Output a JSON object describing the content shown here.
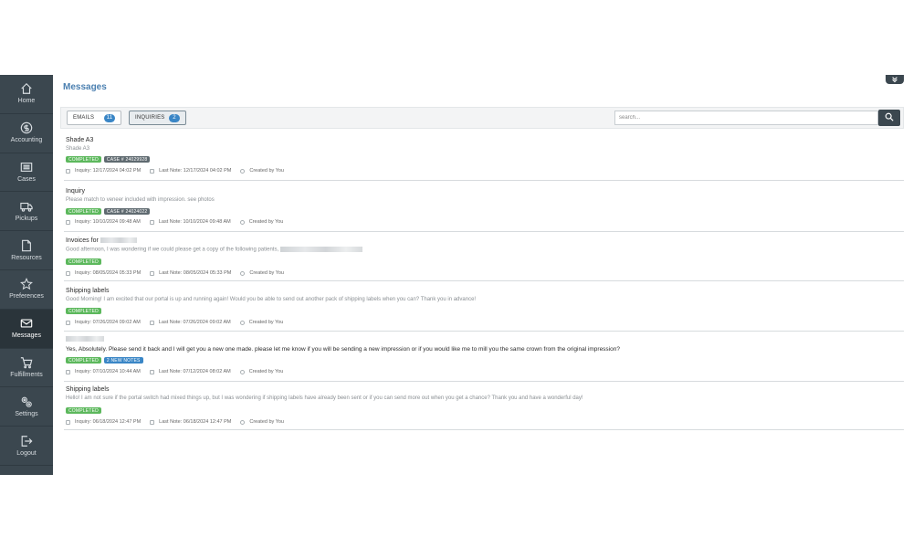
{
  "sidebar": {
    "items": [
      {
        "label": "Home",
        "icon": "home-icon"
      },
      {
        "label": "Accounting",
        "icon": "dollar-icon"
      },
      {
        "label": "Cases",
        "icon": "list-icon"
      },
      {
        "label": "Pickups",
        "icon": "truck-icon"
      },
      {
        "label": "Resources",
        "icon": "document-icon"
      },
      {
        "label": "Preferences",
        "icon": "star-icon"
      },
      {
        "label": "Messages",
        "icon": "envelope-icon",
        "active": true
      },
      {
        "label": "Fulfillments",
        "icon": "cart-icon"
      },
      {
        "label": "Settings",
        "icon": "gears-icon"
      },
      {
        "label": "Logout",
        "icon": "logout-icon"
      }
    ]
  },
  "header": {
    "title": "Messages"
  },
  "tabs": {
    "emails": {
      "label": "EMAILS",
      "count": "11"
    },
    "inquiries": {
      "label": "INQUIRIES",
      "count": "2"
    }
  },
  "search": {
    "placeholder": "search..."
  },
  "messages": [
    {
      "title": "Shade A3",
      "preview": "Shade A3",
      "badges": [
        "COMPLETED",
        "CASE # 24029928"
      ],
      "inquiry": "Inquiry: 12/17/2024 04:02 PM",
      "last_note": "Last Note: 12/17/2024 04:02 PM",
      "created": "Created by You"
    },
    {
      "title": "Inquiry",
      "preview": "Please match to veneer included with impression. see photos",
      "badges": [
        "COMPLETED",
        "CASE # 24024022"
      ],
      "inquiry": "Inquiry: 10/10/2024 09:48 AM",
      "last_note": "Last Note: 10/10/2024 09:48 AM",
      "created": "Created by You"
    },
    {
      "title": "Invoices for",
      "preview": "Good afternoon, I was wondering if we could please get a copy of the following patients,",
      "badges": [
        "COMPLETED"
      ],
      "inquiry": "Inquiry: 08/05/2024 05:33 PM",
      "last_note": "Last Note: 08/05/2024 05:33 PM",
      "created": "Created by You"
    },
    {
      "title": "Shipping labels",
      "preview": "Good Morning! I am excited that our portal is up and running again! Would you be able to send out another pack of shipping labels when you can? Thank you in advance!",
      "badges": [
        "COMPLETED"
      ],
      "inquiry": "Inquiry: 07/26/2024 09:02 AM",
      "last_note": "Last Note: 07/26/2024 09:02 AM",
      "created": "Created by You"
    },
    {
      "title": "",
      "preview": "Yes, Absolutely. Please send it back and I will get you a new one made. please let me know if you will be sending a new impression or if you would like me to mill you the same crown from the original impression?",
      "badges": [
        "COMPLETED",
        "2 NEW NOTES"
      ],
      "inquiry": "Inquiry: 07/10/2024 10:44 AM",
      "last_note": "Last Note: 07/12/2024 08:02 AM",
      "created": "Created by You"
    },
    {
      "title": "Shipping labels",
      "preview": "Hello! I am not sure if the portal switch had mixed things up, but I was wondering if shipping labels have already been sent or if you can send more out when you get a chance? Thank you and have a wonderful day!",
      "badges": [
        "COMPLETED"
      ],
      "inquiry": "Inquiry: 06/18/2024 12:47 PM",
      "last_note": "Last Note: 06/18/2024 12:47 PM",
      "created": "Created by You"
    }
  ]
}
